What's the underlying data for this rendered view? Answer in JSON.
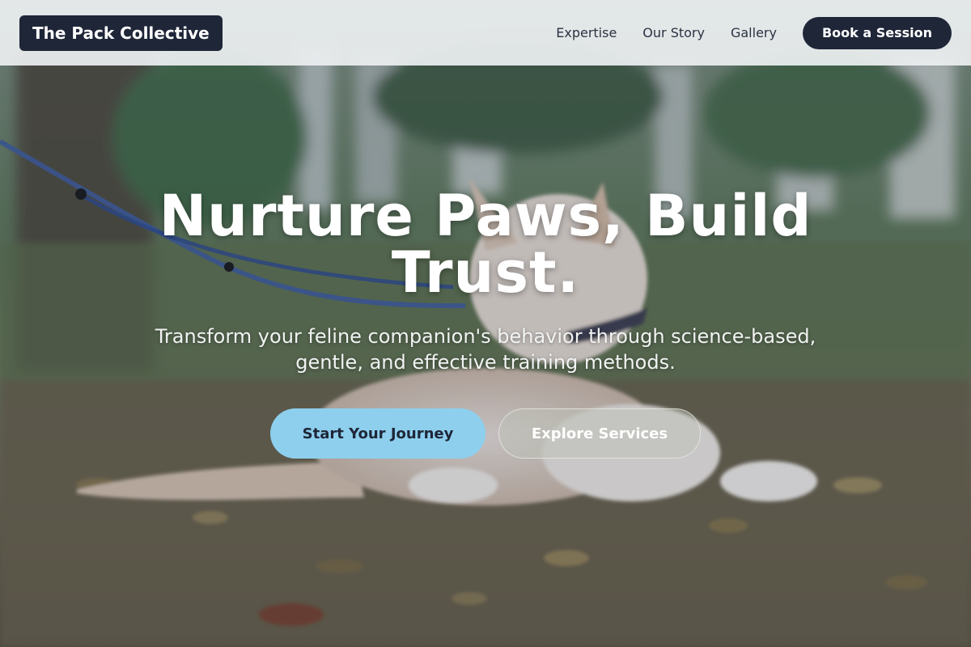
{
  "header": {
    "brand": "The Pack Collective",
    "nav": [
      {
        "label": "Expertise"
      },
      {
        "label": "Our Story"
      },
      {
        "label": "Gallery"
      }
    ],
    "book_label": "Book a Session"
  },
  "hero": {
    "title": "Nurture Paws, Build Trust.",
    "subtitle": "Transform your feline companion's behavior through science-based, gentle, and effective training methods.",
    "primary_cta": "Start Your Journey",
    "secondary_cta": "Explore Services"
  },
  "colors": {
    "dark": "#1e2638",
    "accent": "#8ecfee",
    "header_bg": "#eceff0"
  }
}
